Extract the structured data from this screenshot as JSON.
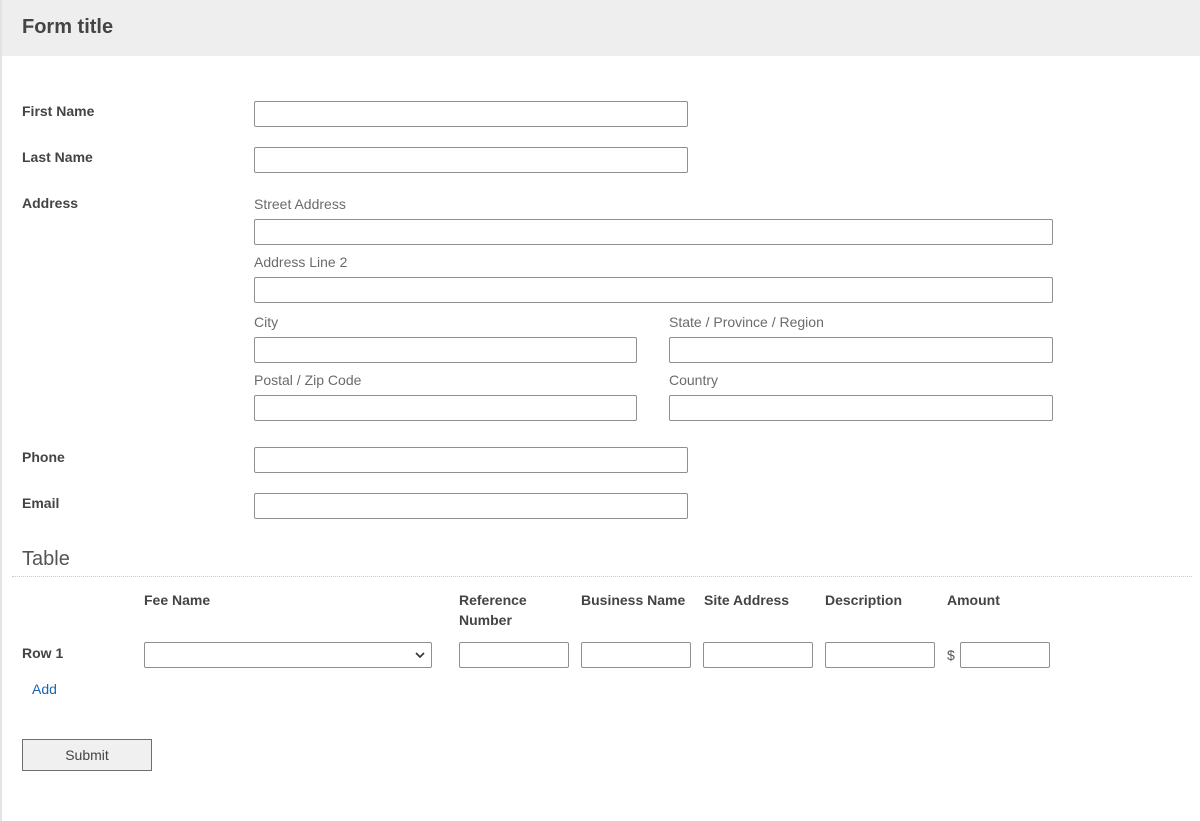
{
  "form": {
    "title": "Form title"
  },
  "fields": {
    "first_name": {
      "label": "First Name",
      "value": ""
    },
    "last_name": {
      "label": "Last Name",
      "value": ""
    },
    "address": {
      "label": "Address",
      "street_label": "Street Address",
      "line2_label": "Address Line 2",
      "city_label": "City",
      "state_label": "State / Province / Region",
      "postal_label": "Postal / Zip Code",
      "country_label": "Country"
    },
    "phone": {
      "label": "Phone",
      "value": ""
    },
    "email": {
      "label": "Email",
      "value": ""
    }
  },
  "table": {
    "title": "Table",
    "columns": [
      "Fee Name",
      "Reference Number",
      "Business Name",
      "Site Address",
      "Description",
      "Amount"
    ],
    "column_lines": {
      "reference_line1": "Reference",
      "reference_line2": "Number"
    },
    "rows": [
      {
        "label": "Row 1",
        "fee_name": "",
        "reference_number": "",
        "business_name": "",
        "site_address": "",
        "description": "",
        "amount": ""
      }
    ],
    "currency_symbol": "$",
    "add_label": "Add"
  },
  "actions": {
    "submit_label": "Submit"
  },
  "colors": {
    "header_bg": "#eeeeee",
    "link": "#1a66b3",
    "border": "#8f8f8f"
  }
}
